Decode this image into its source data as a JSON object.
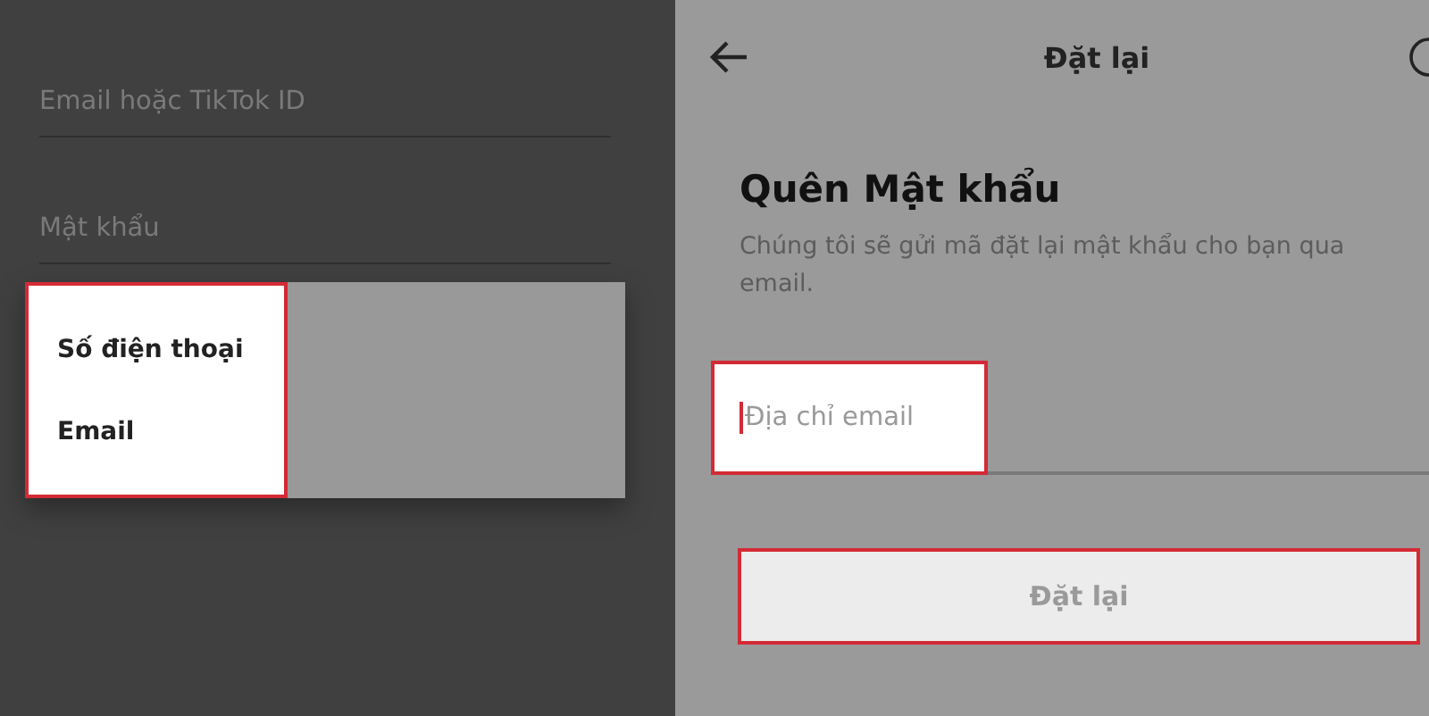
{
  "login_screen": {
    "fields": [
      {
        "label": "Email hoặc TikTok ID"
      },
      {
        "label": "Mật khẩu"
      }
    ],
    "menu": {
      "highlighted": true,
      "items": [
        {
          "label": "Số điện thoại"
        },
        {
          "label": "Email"
        }
      ]
    }
  },
  "reset_screen": {
    "header": {
      "title": "Đặt lại"
    },
    "heading": "Quên Mật khẩu",
    "description": "Chúng tôi sẽ gửi mã đặt lại mật khẩu cho bạn qua email.",
    "email_field": {
      "placeholder": "Địa chỉ email",
      "highlighted": true
    },
    "button": {
      "label": "Đặt lại",
      "highlighted": true,
      "disabled": true
    }
  }
}
